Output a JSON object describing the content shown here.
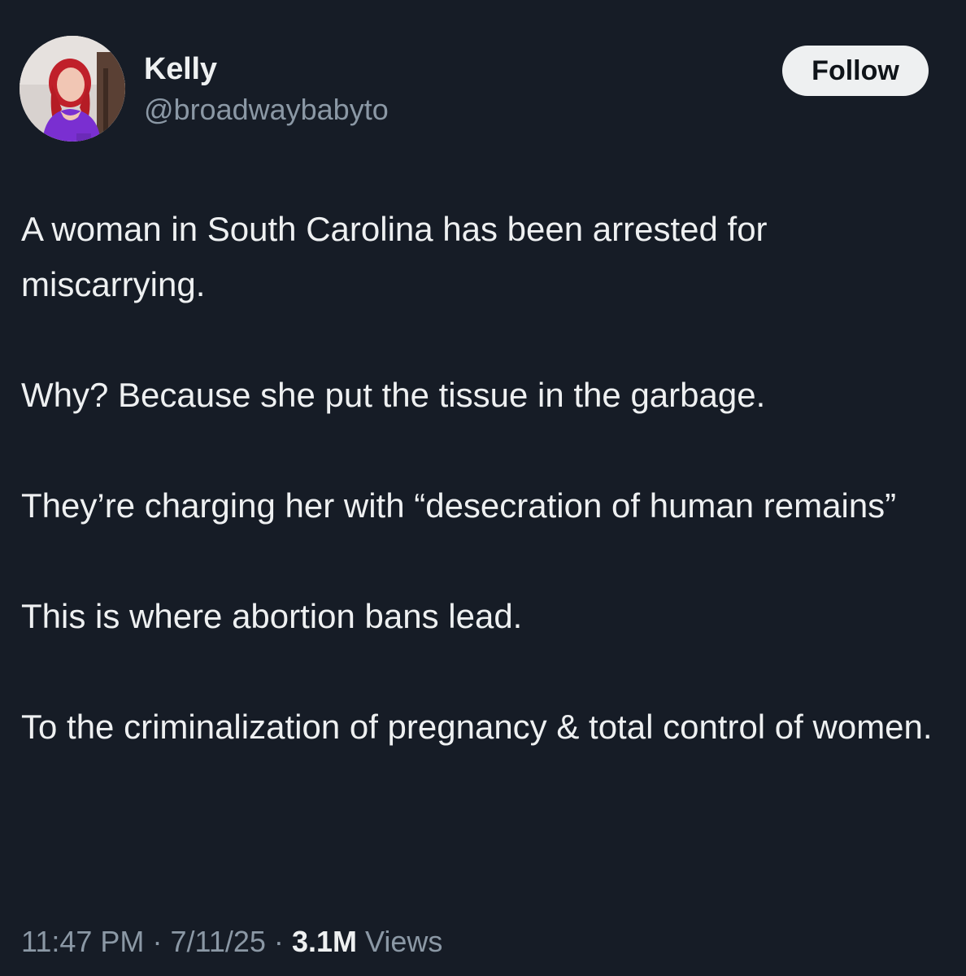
{
  "author": {
    "display_name": "Kelly",
    "handle": "@broadwaybabyto"
  },
  "follow_label": "Follow",
  "tweet": {
    "paragraphs": [
      "A woman in South Carolina has been arrested for miscarrying.",
      "Why? Because she put the tissue in the garbage.",
      "They’re charging her with “desecration of human remains”",
      "This is where abortion bans lead.",
      "To the criminalization of pregnancy & total control of women."
    ]
  },
  "meta": {
    "time": "11:47 PM",
    "separator": "·",
    "date": "7/11/25",
    "views_count": "3.1M",
    "views_label": "Views"
  },
  "colors": {
    "background": "#161c26",
    "text": "#eef0f1",
    "secondary_text": "#8b98a5",
    "follow_button_bg": "#eef0f1"
  }
}
